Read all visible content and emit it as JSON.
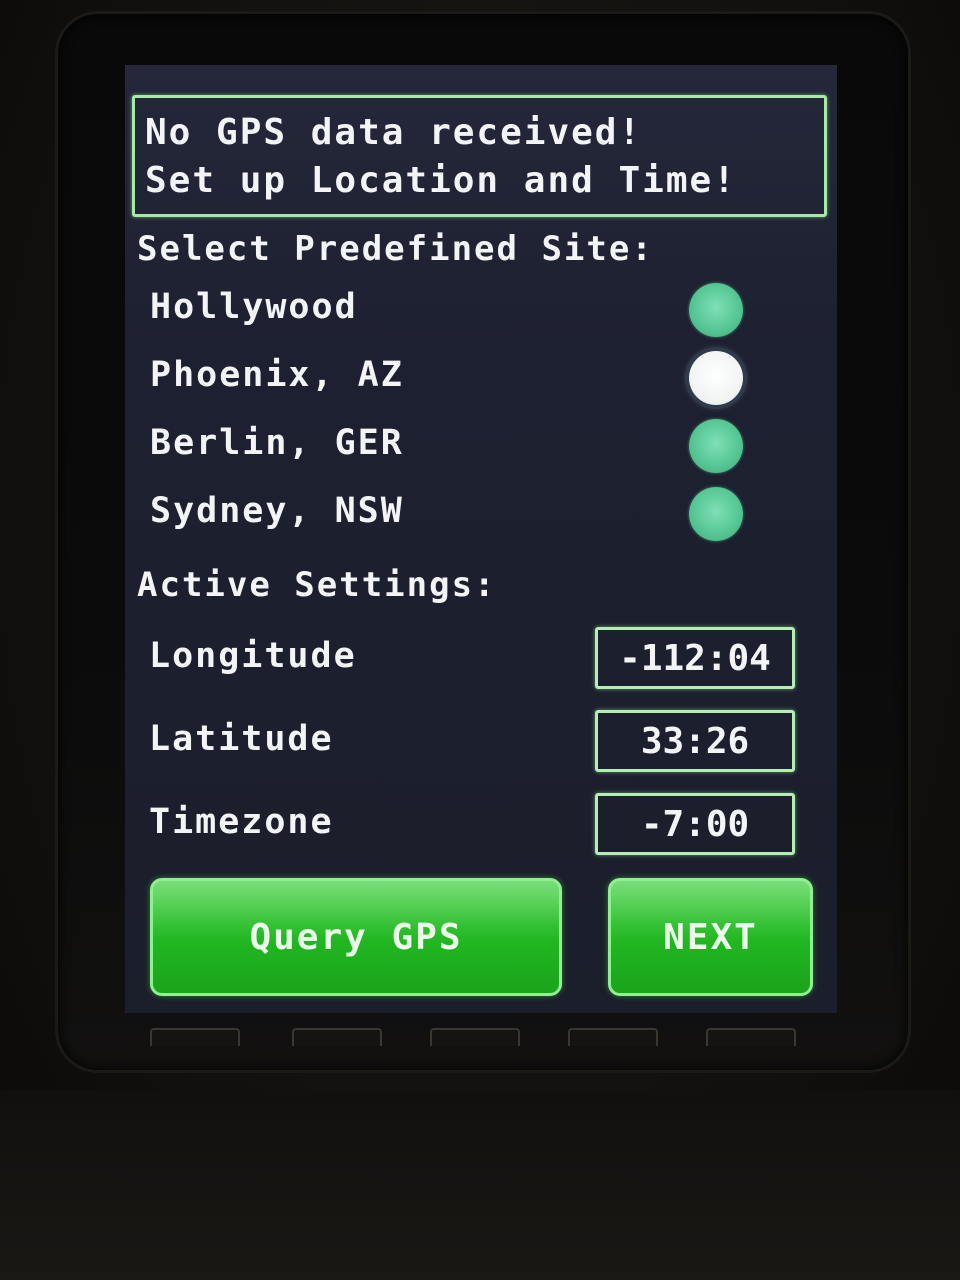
{
  "alert": {
    "line1": "No GPS data received!",
    "line2": "Set up Location and Time!"
  },
  "sites": {
    "heading": "Select Predefined Site:",
    "items": [
      {
        "label": "Hollywood",
        "selected": false
      },
      {
        "label": "Phoenix, AZ",
        "selected": true
      },
      {
        "label": "Berlin, GER",
        "selected": false
      },
      {
        "label": "Sydney, NSW",
        "selected": false
      }
    ]
  },
  "settings": {
    "heading": "Active Settings:",
    "longitude": {
      "label": "Longitude",
      "value": "-112:04"
    },
    "latitude": {
      "label": "Latitude",
      "value": "33:26"
    },
    "timezone": {
      "label": "Timezone",
      "value": "-7:00"
    }
  },
  "buttons": {
    "query_gps": "Query GPS",
    "next": "NEXT"
  },
  "colors": {
    "screen_bg": "#1d2030",
    "frame_green": "#a8e9a8",
    "radio_green": "#58c796",
    "button_green": "#22b822",
    "text": "#f2f4f6"
  }
}
